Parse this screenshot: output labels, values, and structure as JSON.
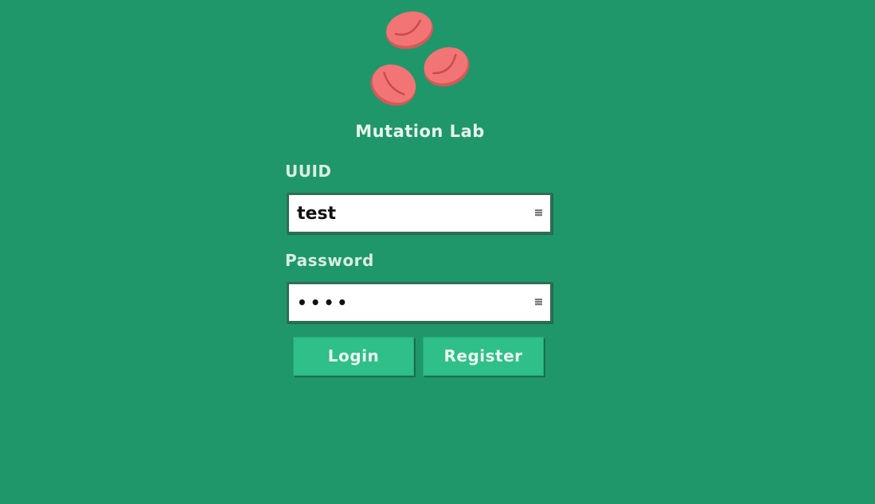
{
  "app": {
    "title": "Mutation Lab",
    "logo_icon": "red-blood-cells-icon"
  },
  "form": {
    "uuid": {
      "label": "UUID",
      "value": "test"
    },
    "password": {
      "label": "Password",
      "value": "test"
    },
    "buttons": {
      "login_label": "Login",
      "register_label": "Register"
    }
  },
  "colors": {
    "background": "#1f976b",
    "button": "#2fbf88",
    "cell": "#f07070"
  }
}
